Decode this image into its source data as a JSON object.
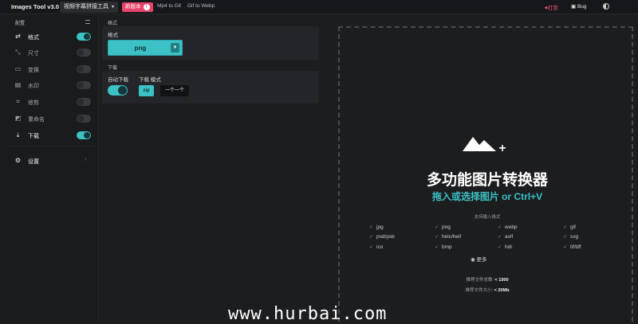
{
  "topbar": {
    "app_title": "Images Tool v3.0",
    "tool_select": "视频字幕拼接工具",
    "new_version": "新版本",
    "new_badge": "!",
    "links": [
      "Mp4 to Gif",
      "Gif to Webp"
    ],
    "tip": "打赏",
    "bug": "Bug"
  },
  "sidebar": {
    "header": "配置",
    "items": [
      {
        "label": "格式",
        "icon": "swap-arrows-icon",
        "enabled": true
      },
      {
        "label": "尺寸",
        "icon": "resize-icon",
        "enabled": false
      },
      {
        "label": "变换",
        "icon": "transform-icon",
        "enabled": false
      },
      {
        "label": "水印",
        "icon": "watermark-icon",
        "enabled": false
      },
      {
        "label": "修剪",
        "icon": "crop-icon",
        "enabled": false
      },
      {
        "label": "重命名",
        "icon": "rename-icon",
        "enabled": false
      },
      {
        "label": "下载",
        "icon": "download-icon",
        "enabled": true
      }
    ],
    "settings": "设置",
    "settings_chevron": "›"
  },
  "panel": {
    "format_section": "格式",
    "format_label": "格式",
    "format_value": "png",
    "download_section": "下载",
    "auto_download_label": "自动下载",
    "download_mode_label": "下载 模式",
    "zip_label": "zip",
    "mode_value": "一个一个"
  },
  "dropzone": {
    "title": "多功能图片转换器",
    "subtitle": "拖入或选择图片 or Ctrl+V",
    "supported_header": "支持输入格式",
    "formats": [
      "jpg",
      "png",
      "webp",
      "gif",
      "psd/psb",
      "heic/heif",
      "avif",
      "svg",
      "ico",
      "bmp",
      "hdr",
      "tif/tiff"
    ],
    "more": "更多",
    "total_label": "推荐文件总数:",
    "total_value": "< 1000",
    "size_label": "推荐文件大小:",
    "size_value": "< 20Mb"
  },
  "watermark": "www.hurbai.com",
  "colors": {
    "accent": "#3cc2c6",
    "brand_pink": "#e8436a"
  }
}
